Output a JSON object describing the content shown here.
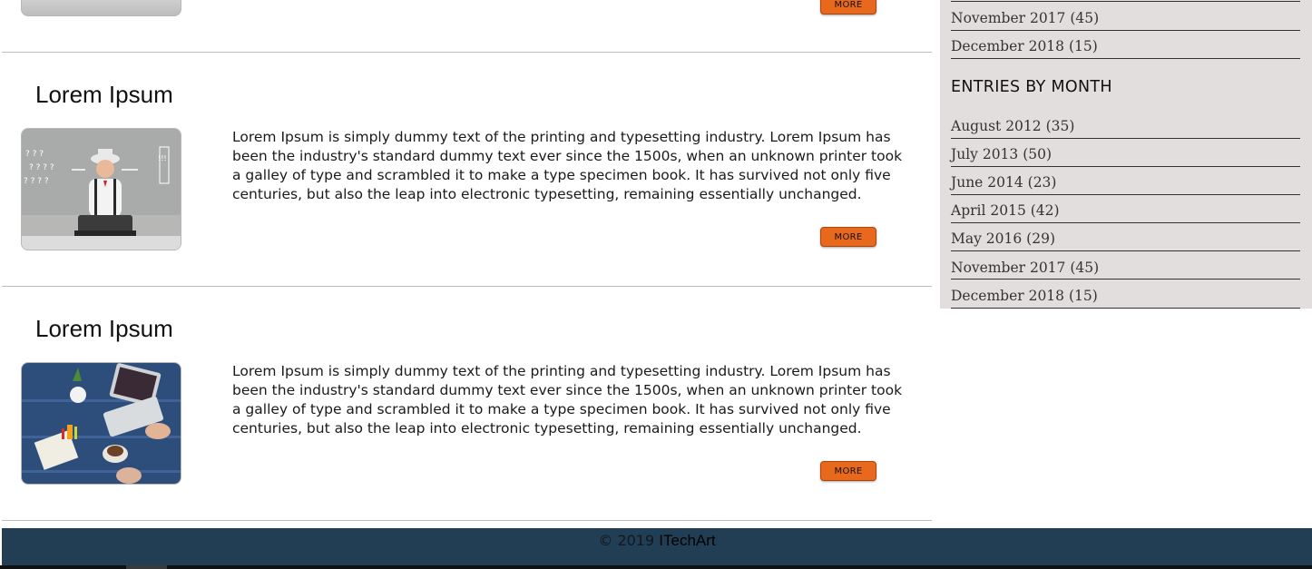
{
  "main": {
    "more_label": "MORE",
    "articles": [
      {
        "title": "Lorem Ipsum",
        "text": "Lorem Ipsum is simply dummy text of the printing and typesetting industry. Lorem Ipsum has been the industry's standard dummy text ever since the 1500s, when an unknown printer took a galley of type and scrambled it to make a type specimen book. It has survived not only five centuries, but also the leap into electronic typesetting, remaining essentially unchanged."
      },
      {
        "title": "Lorem Ipsum",
        "text": "Lorem Ipsum is simply dummy text of the printing and typesetting industry. Lorem Ipsum has been the industry's standard dummy text ever since the 1500s, when an unknown printer took a galley of type and scrambled it to make a type specimen book. It has survived not only five centuries, but also the leap into electronic typesetting, remaining essentially unchanged."
      }
    ]
  },
  "sidebar": {
    "top_items": [
      "November 2017 (45)",
      "December 2018 (15)"
    ],
    "heading": "ENTRIES BY MONTH",
    "items": [
      "August 2012 (35)",
      "July 2013 (50)",
      "June 2014 (23)",
      "April 2015 (42)",
      "May 2016 (29)",
      "November 2017 (45)",
      "December 2018 (15)"
    ]
  },
  "footer": {
    "copyright": "© 2019",
    "brand": "ITechArt"
  },
  "colors": {
    "accent_button": "#e8691b",
    "footer_bg": "#223e54",
    "sidebar_bg": "#e2dedd"
  }
}
